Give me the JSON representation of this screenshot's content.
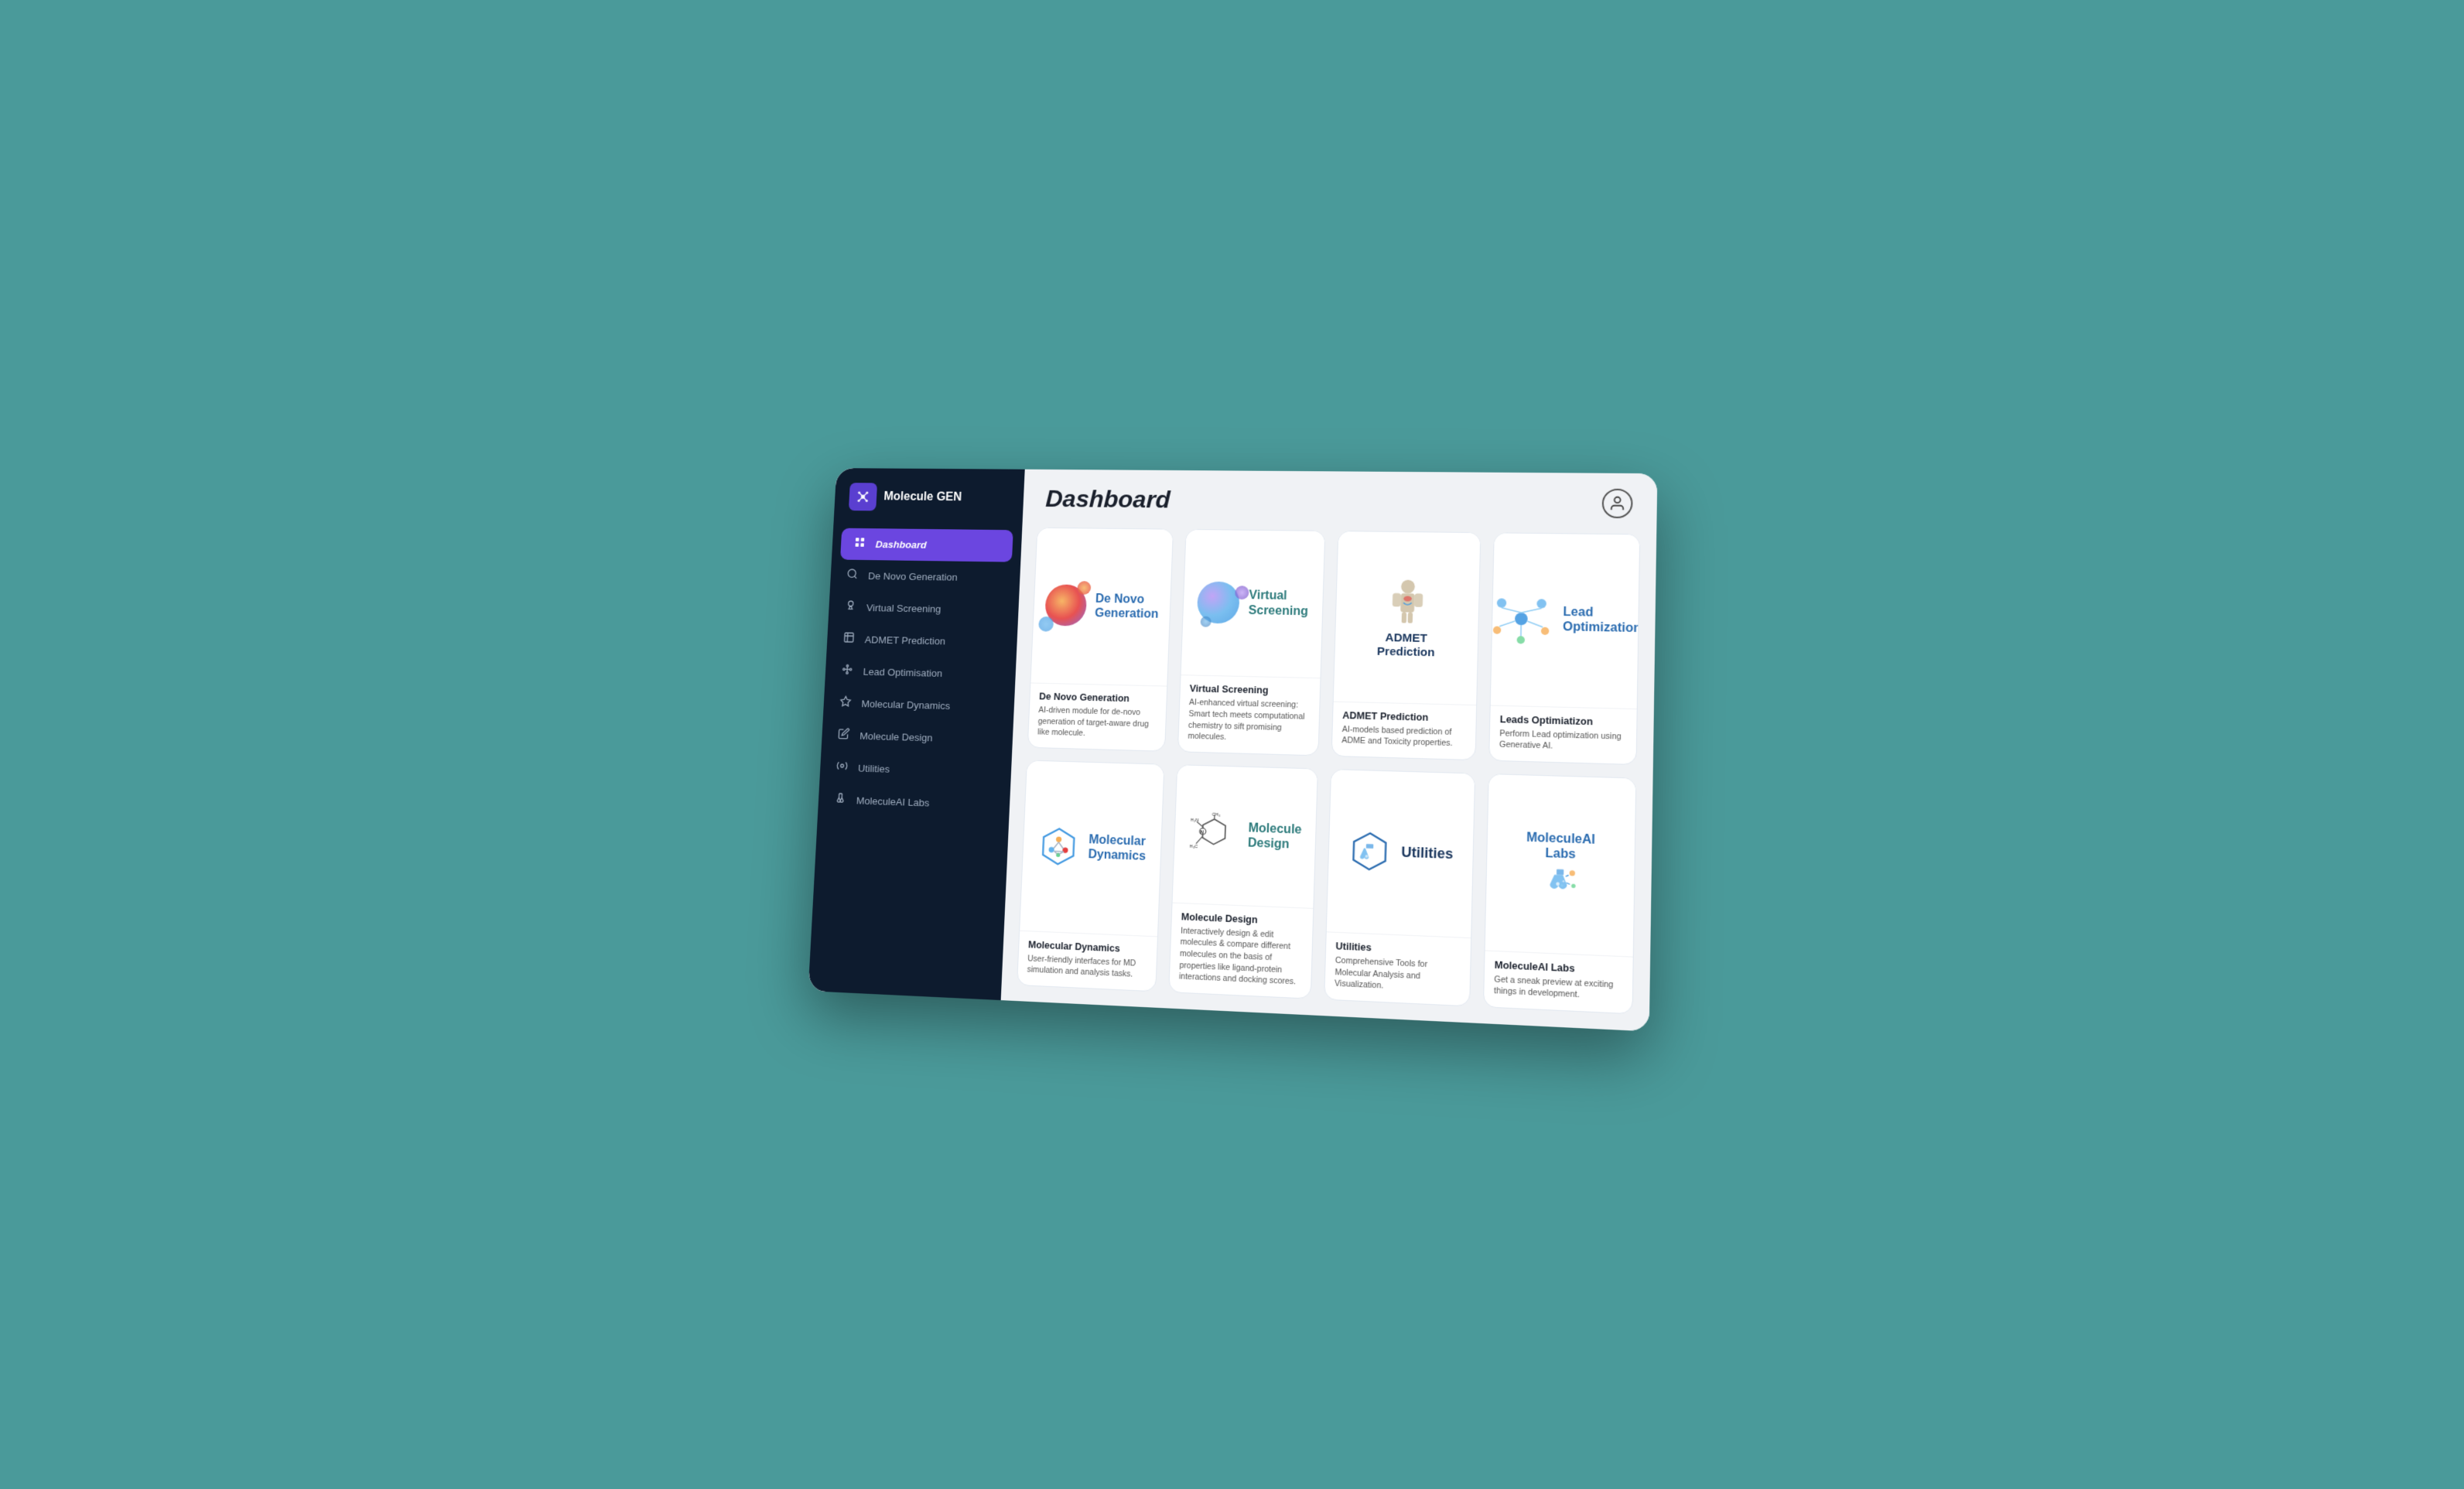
{
  "app": {
    "name": "Molecule GEN"
  },
  "header": {
    "title": "Dashboard",
    "user_icon": "👤"
  },
  "sidebar": {
    "items": [
      {
        "label": "Dashboard",
        "icon": "🏠",
        "active": true
      },
      {
        "label": "De Novo Generation",
        "icon": "🔍"
      },
      {
        "label": "Virtual Screening",
        "icon": "🔬"
      },
      {
        "label": "ADMET Prediction",
        "icon": "⚗️"
      },
      {
        "label": "Lead Optimisation",
        "icon": "🔗"
      },
      {
        "label": "Molecular Dynamics",
        "icon": "⚙️"
      },
      {
        "label": "Molecule Design",
        "icon": "✏️"
      },
      {
        "label": "Utilities",
        "icon": "🛠️"
      },
      {
        "label": "MoleculeAI Labs",
        "icon": "🧪"
      }
    ]
  },
  "cards": [
    {
      "id": "de-novo",
      "title": "De Novo Generation",
      "description": "AI-driven module for de-novo generation of target-aware drug like molecule.",
      "visual_label": "De Novo\nGeneration",
      "color": "#2b6cb0"
    },
    {
      "id": "virtual-screening",
      "title": "Virtual Screening",
      "description": "AI-enhanced virtual screening: Smart tech meets computational chemistry to sift promising molecules.",
      "visual_label": "Virtual\nScreening",
      "color": "#2c7a7b"
    },
    {
      "id": "admet",
      "title": "ADMET Prediction",
      "description": "AI-models based prediction of ADME and Toxicity properties.",
      "visual_label": "ADMET\nPrediction",
      "color": "#1a365d"
    },
    {
      "id": "lead-opt",
      "title": "Leads Optimiatizon",
      "description": "Perform Lead optimization using Generative AI.",
      "visual_label": "Lead\nOptimization",
      "color": "#2b6cb0"
    },
    {
      "id": "mol-dynamics",
      "title": "Molecular Dynamics",
      "description": "User-friendly interfaces for MD simulation and analysis tasks.",
      "visual_label": "Molecular\nDynamics",
      "color": "#2b6cb0"
    },
    {
      "id": "mol-design",
      "title": "Molecule Design",
      "description": "Interactively design & edit molecules & compare different molecules on the basis of properties like ligand-protein interactions and docking scores.",
      "visual_label": "Molecule\nDesign",
      "color": "#2c7a7b"
    },
    {
      "id": "utilities",
      "title": "Utilities",
      "description": "Comprehensive Tools for Molecular Analysis and Visualization.",
      "visual_label": "Utilities",
      "color": "#1a365d"
    },
    {
      "id": "molecule-labs",
      "title": "MoleculeAI Labs",
      "description": "Get a sneak preview at exciting things in development.",
      "visual_label": "MoleculeAI\nLabs 🧪",
      "color": "#2b6cb0"
    }
  ]
}
